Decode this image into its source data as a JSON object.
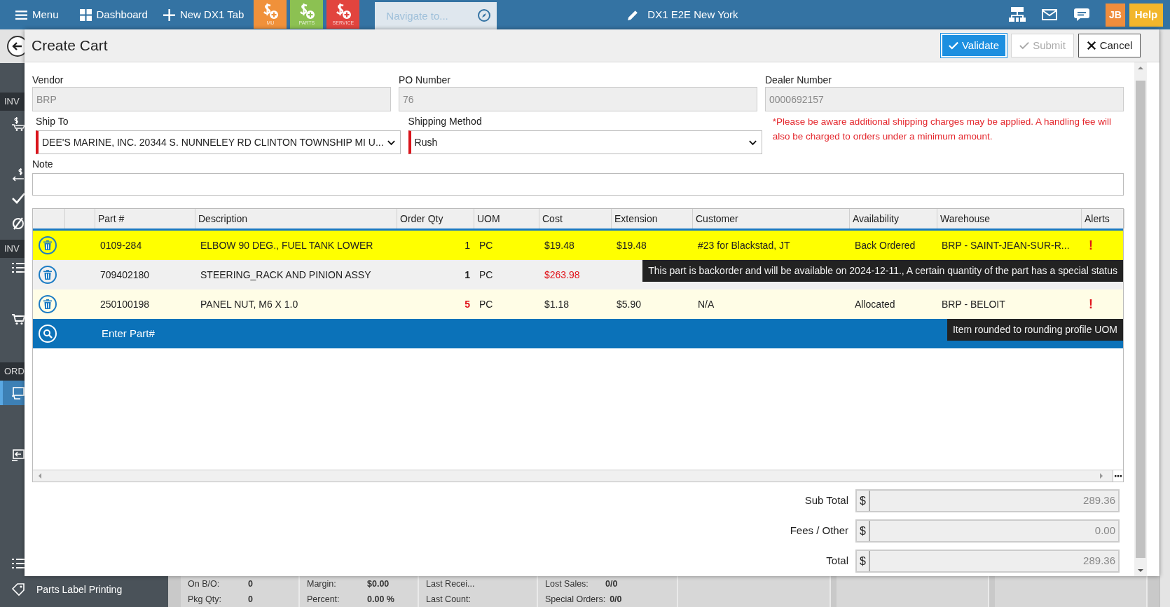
{
  "topbar": {
    "menu": "Menu",
    "dashboard": "Dashboard",
    "new_tab": "New DX1 Tab",
    "tiles": [
      {
        "label": "MU",
        "color": "#f0913a"
      },
      {
        "label": "PARTS",
        "color": "#8cc152"
      },
      {
        "label": "SERVICE",
        "color": "#e2443e"
      }
    ],
    "navigate": {
      "placeholder": "Navigate to..."
    },
    "title": "DX1 E2E New York",
    "user_initials": "JB",
    "help": "Help"
  },
  "sidebar": {
    "items": [
      {
        "kind": "heading",
        "label": "INV"
      },
      {
        "kind": "icon",
        "selected": false
      },
      {
        "kind": "icon",
        "selected": false
      },
      {
        "kind": "icon",
        "selected": false
      },
      {
        "kind": "icon",
        "selected": false
      },
      {
        "kind": "heading",
        "label": "INV"
      },
      {
        "kind": "icon",
        "selected": false
      },
      {
        "kind": "icon",
        "selected": false
      },
      {
        "kind": "heading",
        "label": "ORD"
      },
      {
        "kind": "icon",
        "selected": true
      },
      {
        "kind": "icon",
        "selected": false
      },
      {
        "kind": "icon",
        "selected": false
      },
      {
        "kind": "link",
        "label": "Parts Label Printing",
        "selected": false
      }
    ]
  },
  "info_panels": [
    {
      "rows": [
        {
          "label": "On B/O:",
          "value": "0"
        },
        {
          "label": "Pkg Qty:",
          "value": "0"
        }
      ]
    },
    {
      "rows": [
        {
          "label": "Margin:",
          "value": "$0.00"
        },
        {
          "label": "Percent:",
          "value": "0.00 %"
        }
      ]
    },
    {
      "rows": [
        {
          "label": "Last Recei..."
        },
        {
          "label": "Last Count:"
        }
      ]
    },
    {
      "rows": [
        {
          "label": "Lost Sales:",
          "value": "0/0"
        },
        {
          "label": "Special Orders:",
          "value": "0/0"
        }
      ]
    }
  ],
  "dialog": {
    "title": "Create Cart",
    "buttons": [
      {
        "label": "Validate",
        "kind": "primary",
        "disabled": false
      },
      {
        "label": "Submit",
        "kind": "default",
        "disabled": true
      },
      {
        "label": "Cancel",
        "kind": "default",
        "disabled": false
      }
    ],
    "fields": [
      {
        "label": "Vendor",
        "value": "BRP",
        "disabled": true
      },
      {
        "label": "PO Number",
        "value": "76",
        "disabled": true
      },
      {
        "label": "Dealer Number",
        "value": "0000692157",
        "disabled": true
      }
    ],
    "selects": [
      {
        "label": "Ship To",
        "value": "DEE'S MARINE, INC. 20344 S. NUNNELEY RD CLINTON TOWNSHIP MI U...",
        "required": true
      },
      {
        "label": "Shipping Method",
        "value": "Rush",
        "required": true
      }
    ],
    "shipping_notice": "*Please be aware additional shipping charges may be applied. A handling fee will also be charged to orders under a minimum amount.",
    "note": {
      "label": "Note"
    },
    "grid": {
      "columns": [
        "Part #",
        "Description",
        "Order Qty",
        "UOM",
        "Cost",
        "Extension",
        "Customer",
        "Availability",
        "Warehouse",
        "Alerts"
      ],
      "rows": [
        {
          "part": "0109-284",
          "description": "ELBOW 90 DEG., FUEL TANK LOWER",
          "qty": "1",
          "qty_bold": false,
          "qty_warning": false,
          "uom": "PC",
          "cost": "$19.48",
          "cost_warning": false,
          "extension": "$19.48",
          "customer": "#23 for Blackstad, JT",
          "availability": "Back Ordered",
          "warehouse": "BRP - SAINT-JEAN-SUR-R...",
          "alert": "!",
          "highlighted": true,
          "hovered": false,
          "tooltip": "This part is backorder and will be available on 2024-12-11., A certain quantity of the part has a special status"
        },
        {
          "part": "709402180",
          "description": "STEERING_RACK AND PINION ASSY",
          "qty": "1",
          "qty_bold": true,
          "qty_warning": false,
          "uom": "PC",
          "cost": "$263.98",
          "cost_warning": true,
          "highlighted": false,
          "hovered": true
        },
        {
          "part": "250100198",
          "description": "PANEL NUT, M6 X 1.0",
          "qty": "5",
          "qty_bold": true,
          "qty_warning": true,
          "uom": "PC",
          "cost": "$1.18",
          "cost_warning": false,
          "extension": "$5.90",
          "customer": "N/A",
          "availability": "Allocated",
          "warehouse": "BRP - BELOIT",
          "alert": "!",
          "highlighted": false,
          "hovered": false,
          "tooltip": "Item rounded to rounding profile UOM"
        }
      ],
      "entry": {
        "placeholder": "Enter Part#"
      }
    },
    "totals": [
      {
        "label": "Sub Total",
        "currency": "$",
        "value": "289.36"
      },
      {
        "label": "Fees / Other",
        "currency": "$",
        "value": "0.00"
      },
      {
        "label": "Total",
        "currency": "$",
        "value": "289.36"
      }
    ]
  }
}
